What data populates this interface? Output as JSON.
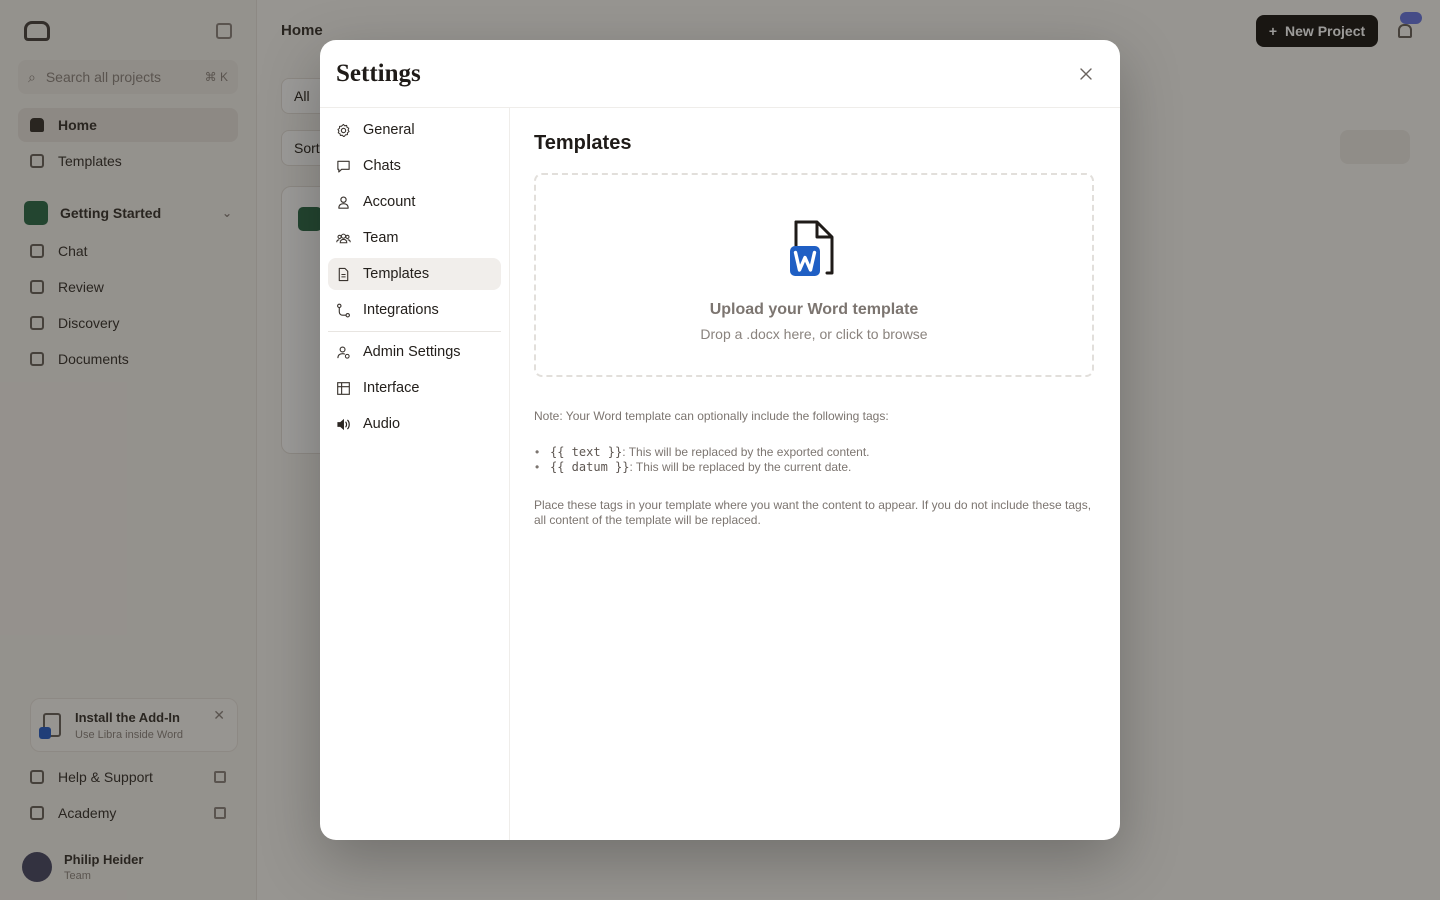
{
  "background": {
    "search_placeholder": "Search all projects",
    "search_shortcut": "⌘ K",
    "nav": [
      {
        "label": "Home"
      },
      {
        "label": "Templates"
      }
    ],
    "project_name": "Getting Started",
    "project_items": [
      {
        "label": "Chat"
      },
      {
        "label": "Review"
      },
      {
        "label": "Discovery"
      },
      {
        "label": "Documents"
      }
    ],
    "addin_title": "Install the Add-In",
    "addin_subtitle": "Use Libra inside Word",
    "help_label": "Help & Support",
    "academy_label": "Academy",
    "user_name": "Philip Heider",
    "user_role": "Team",
    "page_title": "Home",
    "new_project_label": "New Project",
    "filter_all": "All",
    "sort_label": "Sort"
  },
  "modal": {
    "title": "Settings",
    "nav": [
      {
        "label": "General",
        "icon": "gear-icon"
      },
      {
        "label": "Chats",
        "icon": "chat-bubble-icon"
      },
      {
        "label": "Account",
        "icon": "user-icon"
      },
      {
        "label": "Team",
        "icon": "team-icon"
      },
      {
        "label": "Templates",
        "icon": "document-icon",
        "active": true
      },
      {
        "label": "Integrations",
        "icon": "integration-icon"
      },
      {
        "label": "Admin Settings",
        "icon": "admin-user-icon"
      },
      {
        "label": "Interface",
        "icon": "grid-icon"
      },
      {
        "label": "Audio",
        "icon": "speaker-icon"
      }
    ],
    "content": {
      "title": "Templates",
      "upload_title": "Upload your Word template",
      "upload_subtitle": "Drop a .docx here, or click to browse",
      "note": "Note: Your Word template can optionally include the following tags:",
      "tags": [
        {
          "code": "{{ text }}",
          "description": ": This will be replaced by the exported content."
        },
        {
          "code": "{{ datum }}",
          "description": ": This will be replaced by the current date."
        }
      ],
      "placement": "Place these tags in your template where you want the content to appear. If you do not include these tags, all content of the template will be replaced."
    }
  },
  "colors": {
    "word_blue": "#1f5fc4",
    "overlay": "#14100c"
  }
}
